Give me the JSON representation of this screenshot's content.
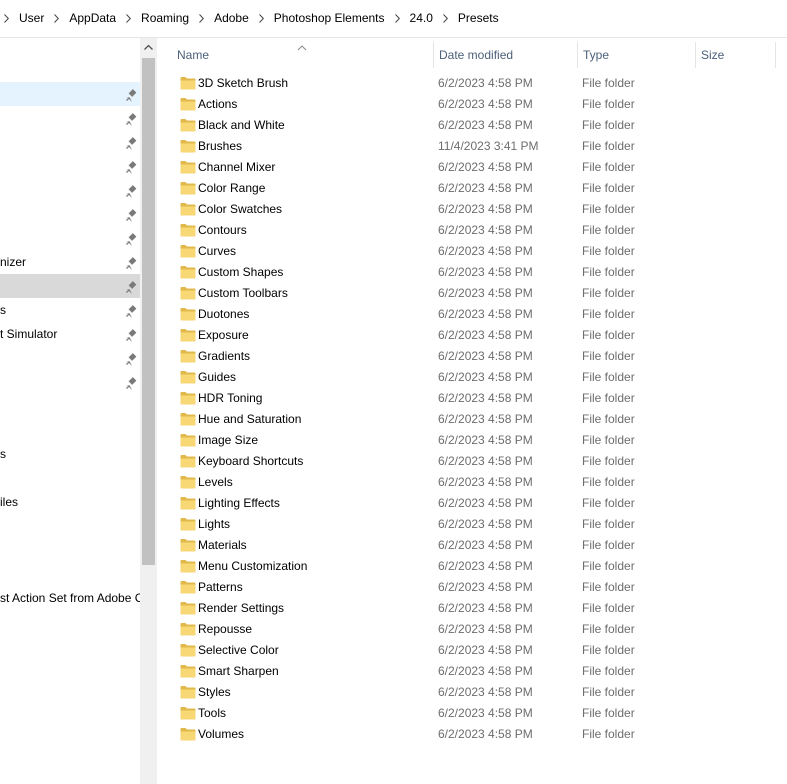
{
  "breadcrumb": [
    "User",
    "AppData",
    "Roaming",
    "Adobe",
    "Photoshop Elements",
    "24.0",
    "Presets"
  ],
  "nav_pane": {
    "items": [
      {
        "label": "",
        "pinned": true,
        "state": "selected-blue"
      },
      {
        "label": "",
        "pinned": true,
        "state": ""
      },
      {
        "label": "",
        "pinned": true,
        "state": ""
      },
      {
        "label": "",
        "pinned": true,
        "state": ""
      },
      {
        "label": "",
        "pinned": true,
        "state": ""
      },
      {
        "label": "",
        "pinned": true,
        "state": ""
      },
      {
        "label": "",
        "pinned": true,
        "state": ""
      },
      {
        "label": "nizer",
        "pinned": true,
        "state": ""
      },
      {
        "label": "",
        "pinned": true,
        "state": "selected-gray"
      },
      {
        "label": "s",
        "pinned": true,
        "state": ""
      },
      {
        "label": "t Simulator",
        "pinned": true,
        "state": ""
      },
      {
        "label": "",
        "pinned": true,
        "state": ""
      },
      {
        "label": "",
        "pinned": true,
        "state": ""
      },
      {
        "label": "",
        "pinned": false,
        "state": ""
      },
      {
        "label": "",
        "pinned": false,
        "state": ""
      },
      {
        "label": "s",
        "pinned": false,
        "state": ""
      },
      {
        "label": "",
        "pinned": false,
        "state": ""
      },
      {
        "label": "iles",
        "pinned": false,
        "state": ""
      },
      {
        "label": "",
        "pinned": false,
        "state": ""
      },
      {
        "label": "",
        "pinned": false,
        "state": ""
      },
      {
        "label": "",
        "pinned": false,
        "state": ""
      },
      {
        "label": "st Action Set from Adobe C",
        "pinned": false,
        "state": ""
      }
    ]
  },
  "columns": {
    "name": "Name",
    "date_modified": "Date modified",
    "type": "Type",
    "size": "Size"
  },
  "sort": {
    "column": "name",
    "direction": "ascending"
  },
  "files": [
    {
      "name": "3D Sketch Brush",
      "date": "6/2/2023 4:58 PM",
      "type": "File folder"
    },
    {
      "name": "Actions",
      "date": "6/2/2023 4:58 PM",
      "type": "File folder"
    },
    {
      "name": "Black and White",
      "date": "6/2/2023 4:58 PM",
      "type": "File folder"
    },
    {
      "name": "Brushes",
      "date": "11/4/2023 3:41 PM",
      "type": "File folder"
    },
    {
      "name": "Channel Mixer",
      "date": "6/2/2023 4:58 PM",
      "type": "File folder"
    },
    {
      "name": "Color Range",
      "date": "6/2/2023 4:58 PM",
      "type": "File folder"
    },
    {
      "name": "Color Swatches",
      "date": "6/2/2023 4:58 PM",
      "type": "File folder"
    },
    {
      "name": "Contours",
      "date": "6/2/2023 4:58 PM",
      "type": "File folder"
    },
    {
      "name": "Curves",
      "date": "6/2/2023 4:58 PM",
      "type": "File folder"
    },
    {
      "name": "Custom Shapes",
      "date": "6/2/2023 4:58 PM",
      "type": "File folder"
    },
    {
      "name": "Custom Toolbars",
      "date": "6/2/2023 4:58 PM",
      "type": "File folder"
    },
    {
      "name": "Duotones",
      "date": "6/2/2023 4:58 PM",
      "type": "File folder"
    },
    {
      "name": "Exposure",
      "date": "6/2/2023 4:58 PM",
      "type": "File folder"
    },
    {
      "name": "Gradients",
      "date": "6/2/2023 4:58 PM",
      "type": "File folder"
    },
    {
      "name": "Guides",
      "date": "6/2/2023 4:58 PM",
      "type": "File folder"
    },
    {
      "name": "HDR Toning",
      "date": "6/2/2023 4:58 PM",
      "type": "File folder"
    },
    {
      "name": "Hue and Saturation",
      "date": "6/2/2023 4:58 PM",
      "type": "File folder"
    },
    {
      "name": "Image Size",
      "date": "6/2/2023 4:58 PM",
      "type": "File folder"
    },
    {
      "name": "Keyboard Shortcuts",
      "date": "6/2/2023 4:58 PM",
      "type": "File folder"
    },
    {
      "name": "Levels",
      "date": "6/2/2023 4:58 PM",
      "type": "File folder"
    },
    {
      "name": "Lighting Effects",
      "date": "6/2/2023 4:58 PM",
      "type": "File folder"
    },
    {
      "name": "Lights",
      "date": "6/2/2023 4:58 PM",
      "type": "File folder"
    },
    {
      "name": "Materials",
      "date": "6/2/2023 4:58 PM",
      "type": "File folder"
    },
    {
      "name": "Menu Customization",
      "date": "6/2/2023 4:58 PM",
      "type": "File folder"
    },
    {
      "name": "Patterns",
      "date": "6/2/2023 4:58 PM",
      "type": "File folder"
    },
    {
      "name": "Render Settings",
      "date": "6/2/2023 4:58 PM",
      "type": "File folder"
    },
    {
      "name": "Repousse",
      "date": "6/2/2023 4:58 PM",
      "type": "File folder"
    },
    {
      "name": "Selective Color",
      "date": "6/2/2023 4:58 PM",
      "type": "File folder"
    },
    {
      "name": "Smart Sharpen",
      "date": "6/2/2023 4:58 PM",
      "type": "File folder"
    },
    {
      "name": "Styles",
      "date": "6/2/2023 4:58 PM",
      "type": "File folder"
    },
    {
      "name": "Tools",
      "date": "6/2/2023 4:58 PM",
      "type": "File folder"
    },
    {
      "name": "Volumes",
      "date": "6/2/2023 4:58 PM",
      "type": "File folder"
    }
  ],
  "icons": {
    "folder": "folder-icon",
    "pin": "pin-icon",
    "separator": "chevron-right-icon",
    "scroll_up": "scroll-up-arrow-icon"
  },
  "colors": {
    "folder": "#f8d775",
    "folder_dark": "#e0b94a",
    "header_text": "#4c607a",
    "secondary_text": "#6d6d6d",
    "selection": "#e5f3ff"
  }
}
